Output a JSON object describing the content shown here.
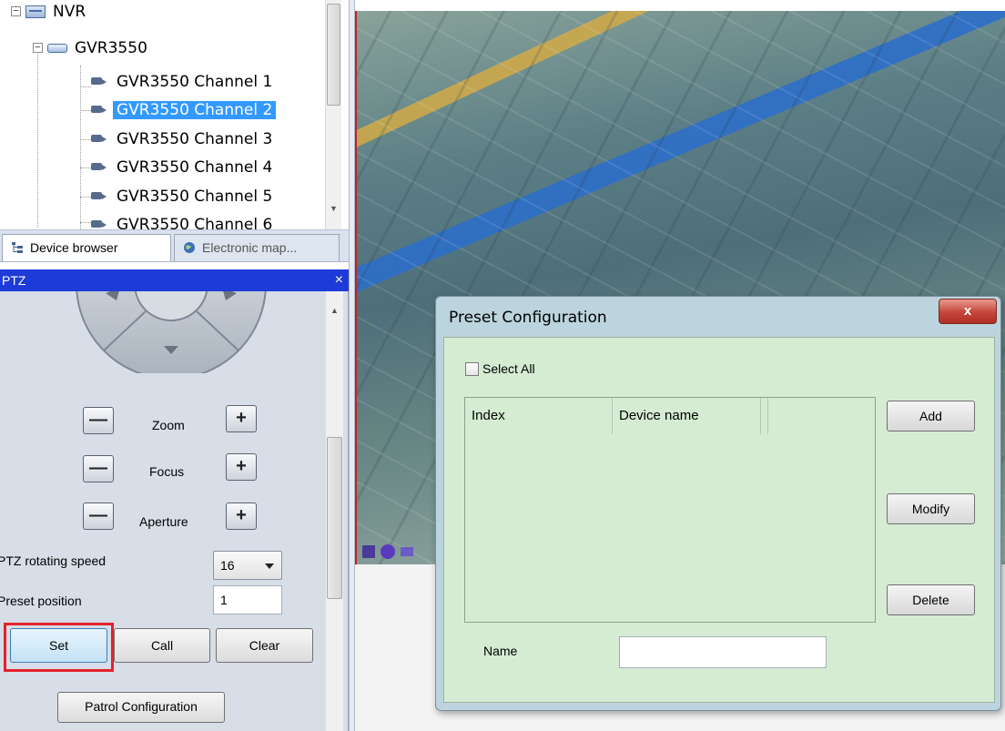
{
  "tree": {
    "root": "NVR",
    "device": "GVR3550",
    "channels": [
      "GVR3550 Channel 1",
      "GVR3550 Channel 2",
      "GVR3550 Channel 3",
      "GVR3550 Channel 4",
      "GVR3550 Channel 5",
      "GVR3550 Channel 6"
    ],
    "selected_index": 1
  },
  "tabs": {
    "device_browser": "Device browser",
    "electronic_map": "Electronic map..."
  },
  "ptz": {
    "title": "PTZ",
    "close": "×",
    "zoom": "Zoom",
    "focus": "Focus",
    "aperture": "Aperture",
    "minus": "—",
    "plus": "+",
    "speed_label": "PTZ rotating speed",
    "speed_value": "16",
    "preset_label": "Preset position",
    "preset_value": "1",
    "set": "Set",
    "call": "Call",
    "clear": "Clear",
    "patrol": "Patrol Configuration"
  },
  "dialog": {
    "title": "Preset Configuration",
    "close": "x",
    "select_all": "Select All",
    "columns": [
      "Index",
      "Device name",
      ""
    ],
    "add": "Add",
    "modify": "Modify",
    "delete": "Delete",
    "name_label": "Name",
    "name_value": ""
  },
  "colors": {
    "ptz_title_bar": "#1d3bd8",
    "selection": "#3399ff",
    "dialog_body": "#d5ecd3",
    "set_highlight": "#e3222a"
  }
}
